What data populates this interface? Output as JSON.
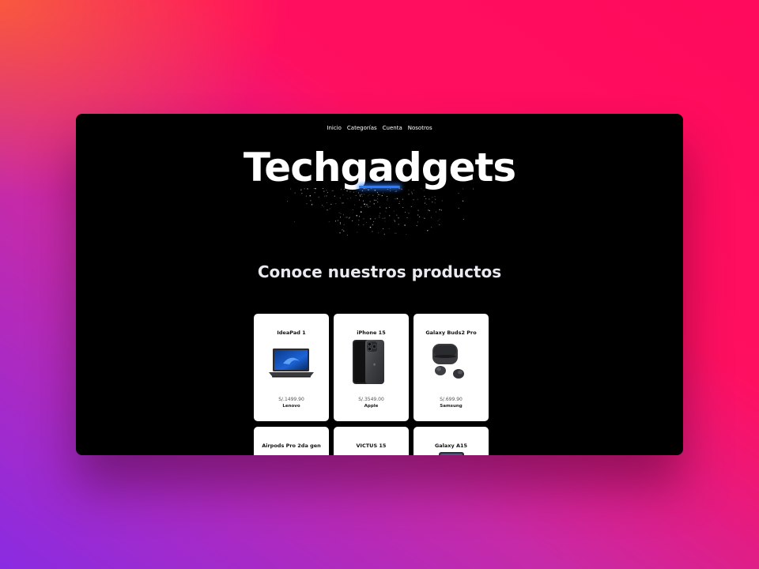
{
  "nav": {
    "items": [
      {
        "label": "Inicio"
      },
      {
        "label": "Categorías"
      },
      {
        "label": "Cuenta"
      },
      {
        "label": "Nosotros"
      }
    ]
  },
  "hero": {
    "brand": "Techgadgets",
    "accent_color": "#2a7bff"
  },
  "products_section": {
    "title": "Conoce nuestros productos"
  },
  "products": [
    {
      "name": "IdeaPad 1",
      "price": "S/.1499.90",
      "brand": "Lenovo",
      "icon": "laptop-image"
    },
    {
      "name": "iPhone 15",
      "price": "S/.3549.00",
      "brand": "Apple",
      "icon": "smartphone-image"
    },
    {
      "name": "Galaxy Buds2 Pro",
      "price": "S/.699.90",
      "brand": "Samsung",
      "icon": "earbuds-image"
    },
    {
      "name": "Airpods Pro 2da gen",
      "price": "",
      "brand": "",
      "icon": "earbuds-image"
    },
    {
      "name": "VICTUS 15",
      "price": "",
      "brand": "",
      "icon": "laptop-image"
    },
    {
      "name": "Galaxy A15",
      "price": "",
      "brand": "",
      "icon": "smartphone-image"
    }
  ]
}
